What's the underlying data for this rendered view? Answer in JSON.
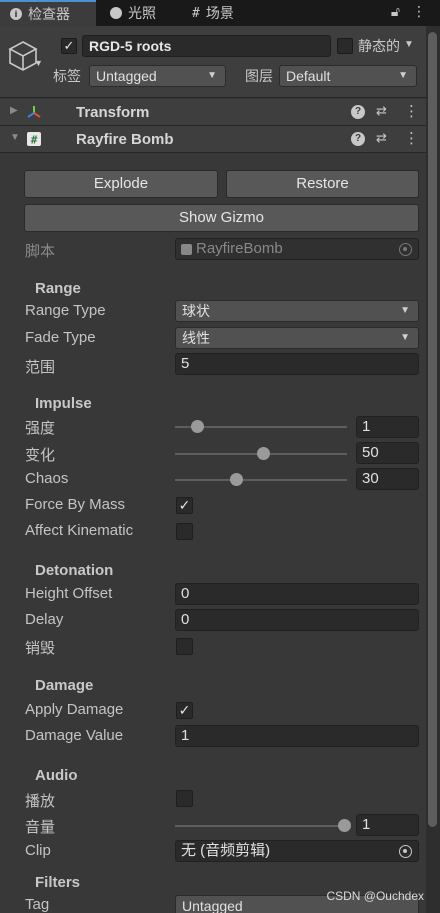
{
  "tabs": [
    {
      "label": "检查器",
      "icon": "info-icon"
    },
    {
      "label": "光照",
      "icon": "lightbulb-icon"
    },
    {
      "label": "场景",
      "icon": "hash-icon"
    }
  ],
  "header": {
    "object_name": "RGD-5 roots",
    "active": true,
    "static_label": "静态的",
    "tag_label": "标签",
    "tag_value": "Untagged",
    "layer_label": "图层",
    "layer_value": "Default"
  },
  "components": {
    "transform": {
      "title": "Transform"
    },
    "bomb": {
      "title": "Rayfire Bomb"
    }
  },
  "buttons": {
    "explode": "Explode",
    "restore": "Restore",
    "show_gizmo": "Show Gizmo"
  },
  "script_row": {
    "label": "脚本",
    "value": "RayfireBomb"
  },
  "range": {
    "title": "Range",
    "range_type_label": "Range Type",
    "range_type_value": "球状",
    "fade_type_label": "Fade Type",
    "fade_type_value": "线性",
    "range_label": "范围",
    "range_value": "5"
  },
  "impulse": {
    "title": "Impulse",
    "strength_label": "强度",
    "strength_value": "1",
    "variation_label": "变化",
    "variation_value": "50",
    "chaos_label": "Chaos",
    "chaos_value": "30",
    "force_by_mass_label": "Force By Mass",
    "force_by_mass": true,
    "affect_kinematic_label": "Affect Kinematic",
    "affect_kinematic": false
  },
  "detonation": {
    "title": "Detonation",
    "height_offset_label": "Height Offset",
    "height_offset_value": "0",
    "delay_label": "Delay",
    "delay_value": "0",
    "destroy_label": "销毁",
    "destroy": false
  },
  "damage": {
    "title": "Damage",
    "apply_damage_label": "Apply Damage",
    "apply_damage": true,
    "damage_value_label": "Damage Value",
    "damage_value": "1"
  },
  "audio": {
    "title": "Audio",
    "play_label": "播放",
    "play": false,
    "volume_label": "音量",
    "volume_value": "1",
    "clip_label": "Clip",
    "clip_value": "无 (音频剪辑)"
  },
  "filters": {
    "title": "Filters",
    "tag_label": "Tag",
    "tag_value": "Untagged"
  },
  "watermark": "CSDN @Ouchdex",
  "colors": {
    "accent": "#4d90d6",
    "background": "#383838"
  }
}
